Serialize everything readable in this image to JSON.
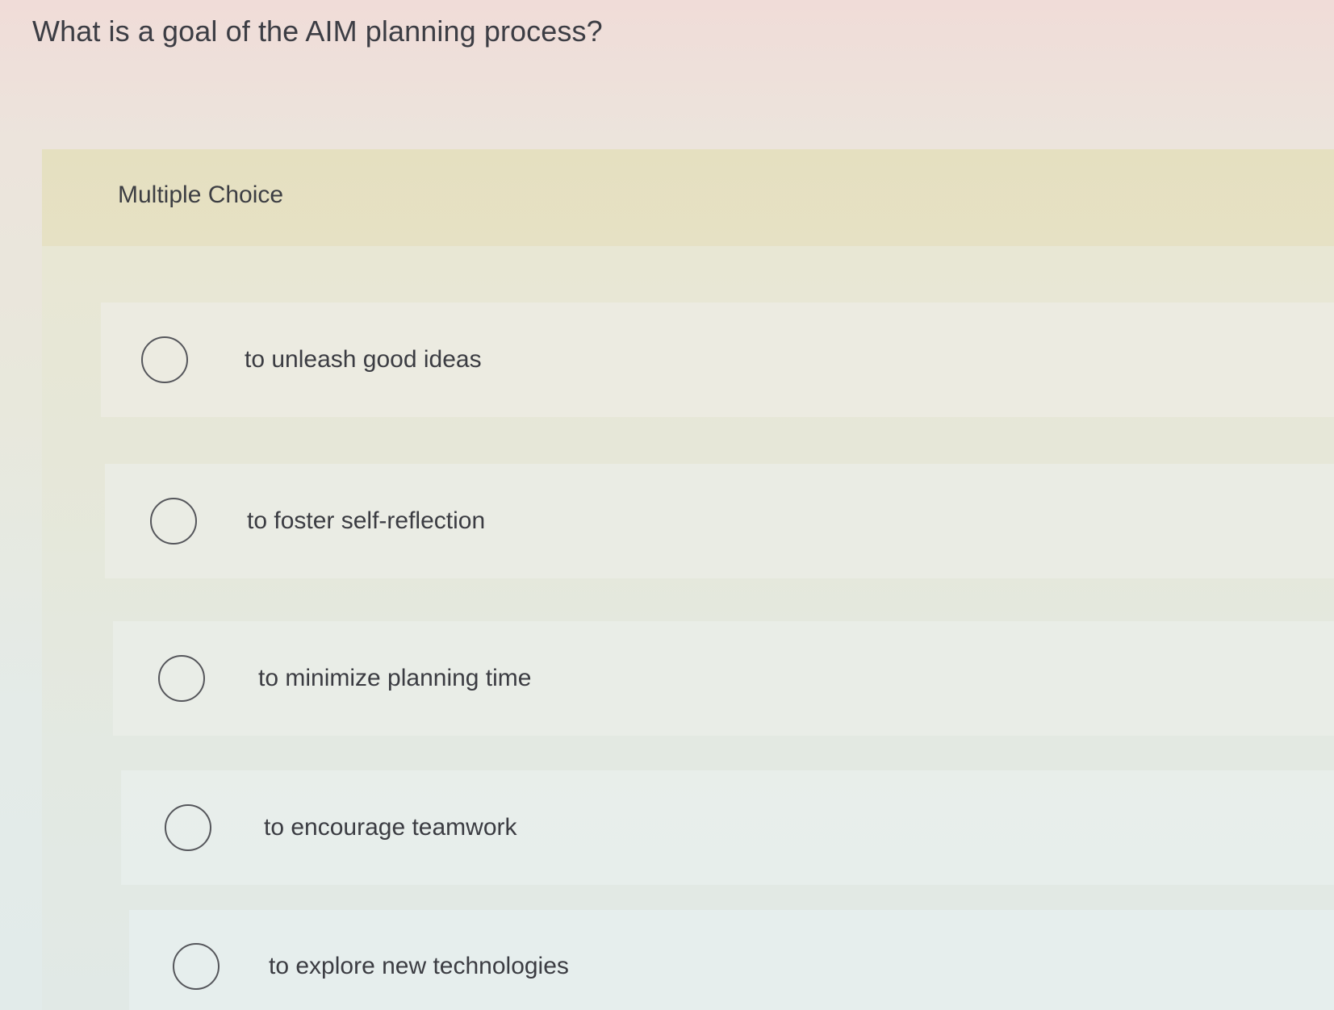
{
  "question": {
    "text": "What is a goal of the AIM planning process?"
  },
  "multiple_choice": {
    "label": "Multiple Choice",
    "options": [
      {
        "label": "to unleash good ideas",
        "selected": false
      },
      {
        "label": "to foster self-reflection",
        "selected": false
      },
      {
        "label": "to minimize planning time",
        "selected": false
      },
      {
        "label": "to encourage teamwork",
        "selected": false
      },
      {
        "label": "to explore new technologies",
        "selected": false
      }
    ]
  },
  "colors": {
    "background_top": "#f0dcd8",
    "panel_header": "#e5e0c0",
    "text": "#3b3c42",
    "radio_border": "#55565b"
  }
}
